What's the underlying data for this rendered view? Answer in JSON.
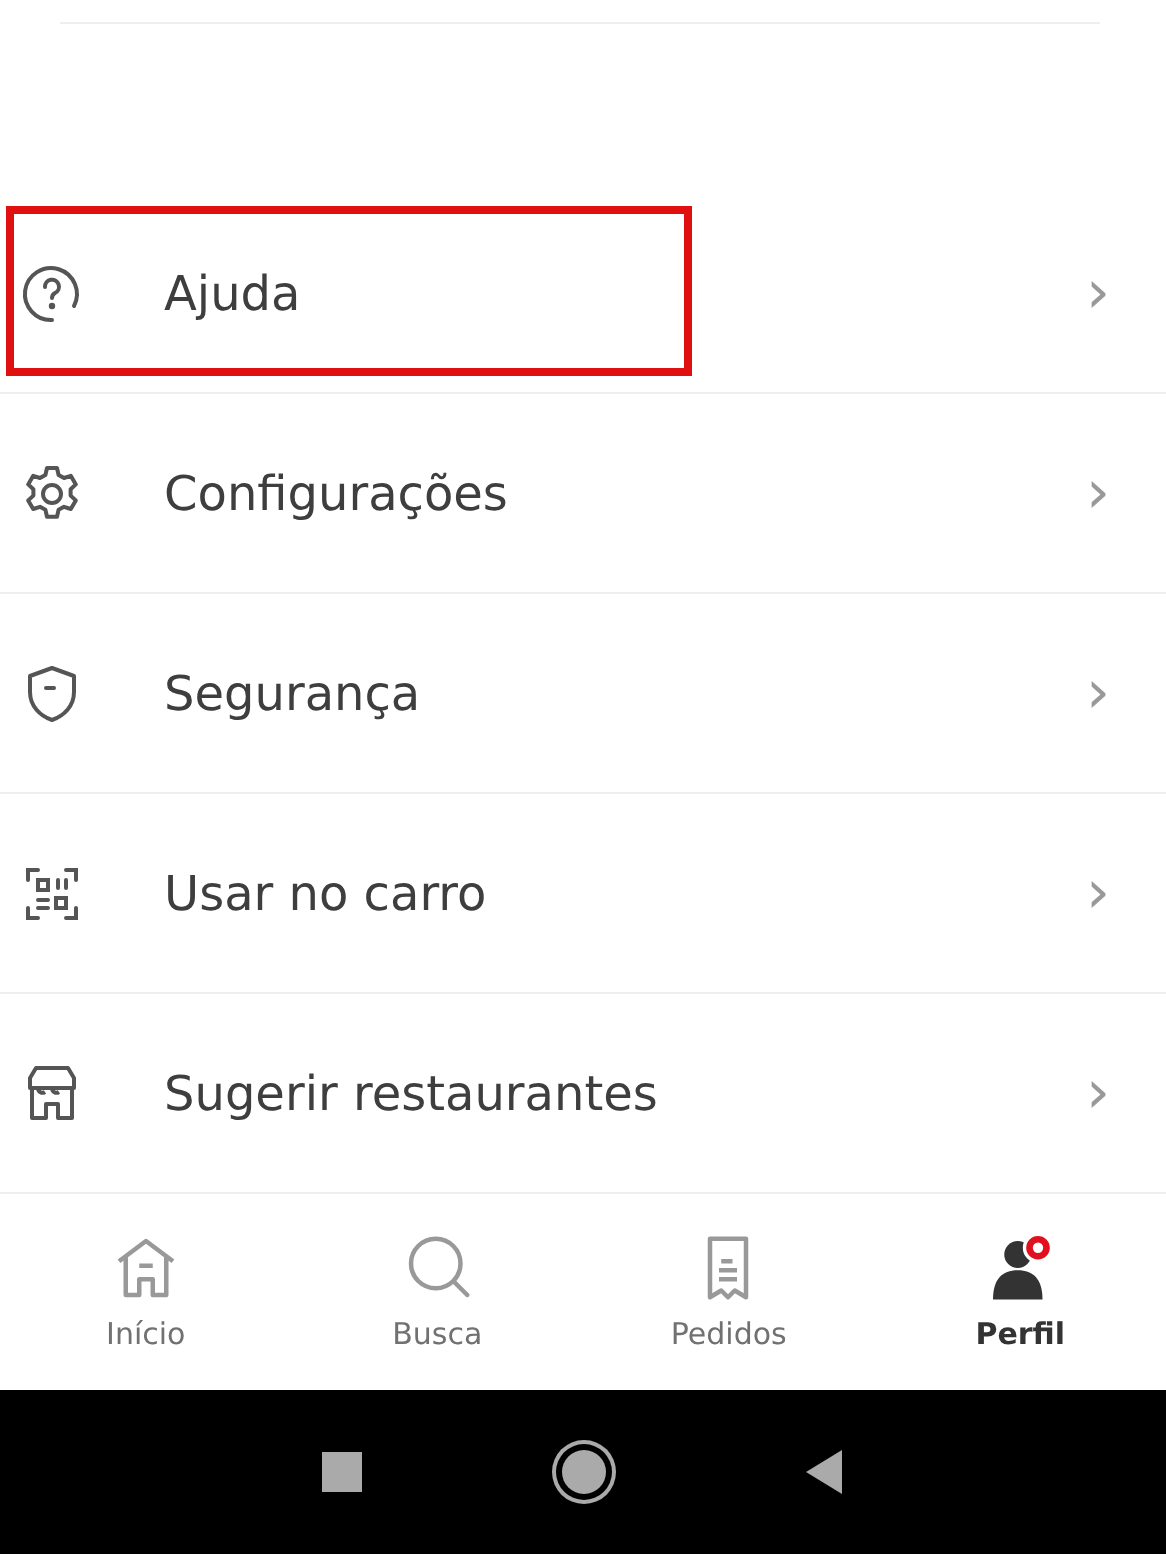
{
  "menu": [
    {
      "kind": "help",
      "label": "Ajuda",
      "chevron": "›",
      "highlighted": true
    },
    {
      "kind": "settings",
      "label": "Configurações",
      "chevron": "›",
      "highlighted": false
    },
    {
      "kind": "shield",
      "label": "Segurança",
      "chevron": "›",
      "highlighted": false
    },
    {
      "kind": "qr",
      "label": "Usar no carro",
      "chevron": "›",
      "highlighted": false
    },
    {
      "kind": "store",
      "label": "Sugerir restaurantes",
      "chevron": "›",
      "highlighted": false
    }
  ],
  "bottom_nav": [
    {
      "kind": "home",
      "label": "Início",
      "selected": false
    },
    {
      "kind": "search",
      "label": "Busca",
      "selected": false
    },
    {
      "kind": "orders",
      "label": "Pedidos",
      "selected": false
    },
    {
      "kind": "profile",
      "label": "Perfil",
      "selected": true,
      "badge": true
    }
  ],
  "system_nav": [
    {
      "kind": "recents"
    },
    {
      "kind": "home"
    },
    {
      "kind": "back"
    }
  ]
}
